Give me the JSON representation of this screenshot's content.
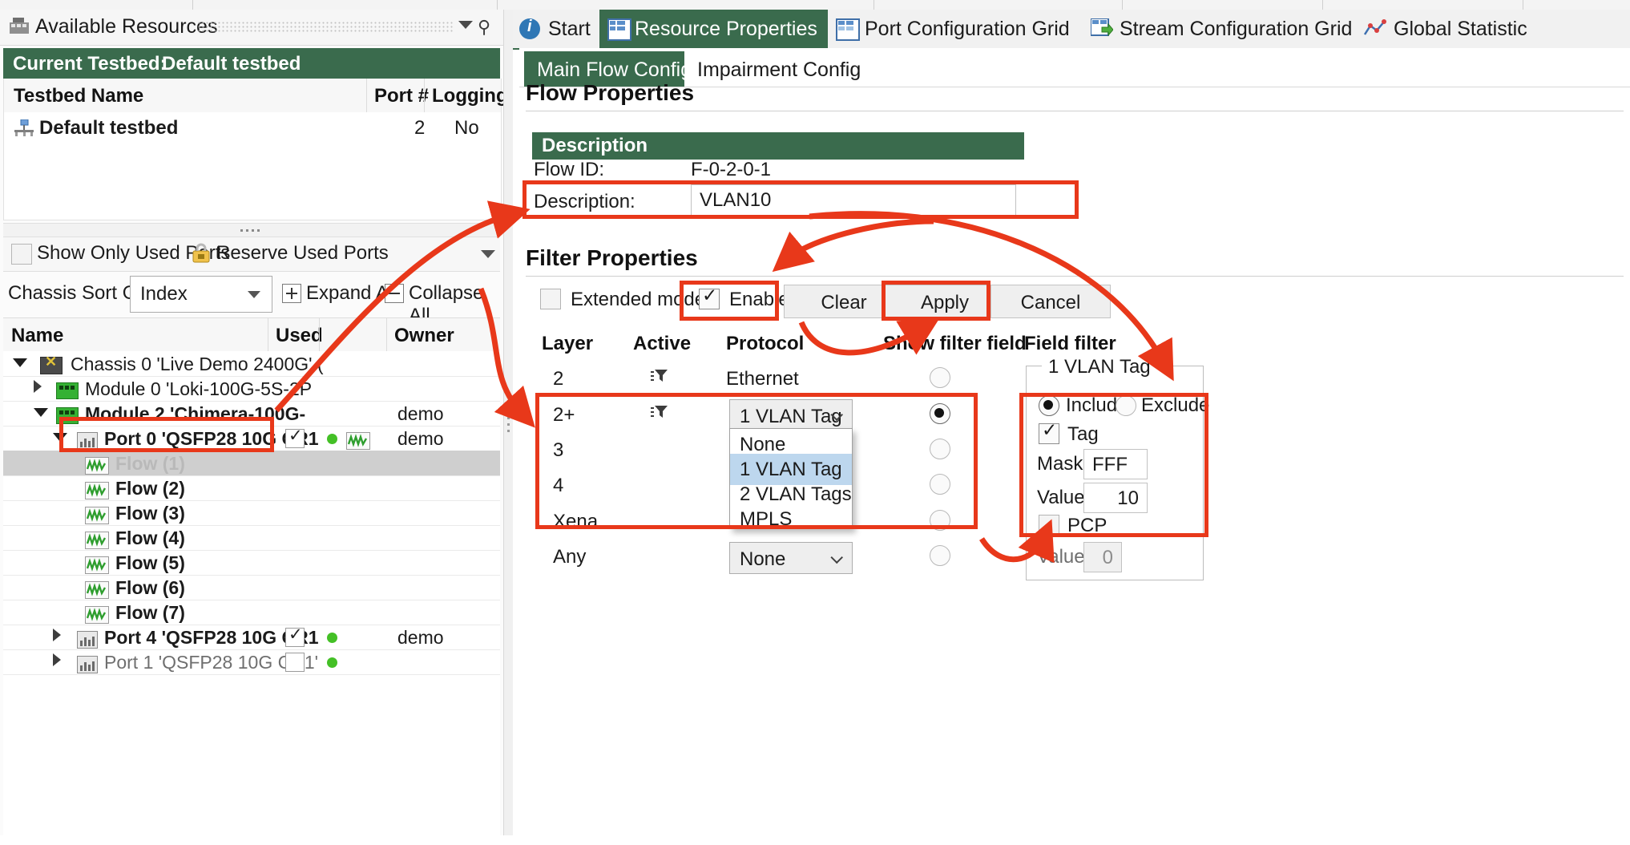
{
  "left_panel": {
    "title": "Available Resources",
    "title_icon": "resources-icon",
    "pin_icon": "pin-icon",
    "collapse_icon": "chevron-down-icon",
    "testbed_header": {
      "prefix": "Current Testbed:",
      "name": "Default testbed"
    },
    "testbed_columns": [
      "Testbed Name",
      "Port #",
      "Logging?"
    ],
    "testbed_rows": [
      {
        "name": "Default testbed",
        "ports": "2",
        "logging": "No",
        "icon": "testbed-icon"
      }
    ],
    "options": {
      "show_only_used_ports": "Show Only Used Ports",
      "show_only_used_ports_checked": false,
      "reserve_used_ports": "Reserve Used Ports",
      "lock_icon": "lock-icon"
    },
    "sort": {
      "label": "Chassis Sort Order:",
      "value": "Index",
      "expand_all": "Expand All",
      "collapse_all": "Collapse All"
    },
    "tree_columns": [
      "Name",
      "Used",
      "",
      "Owner"
    ],
    "tree_rows": [
      {
        "label": "Chassis 0 'Live Demo 2400G' (",
        "indent": 0,
        "icon": "chassis-icon",
        "twisty": "open",
        "bold": false,
        "checkbox": null,
        "dot": false,
        "owner": ""
      },
      {
        "label": "Module 0 'Loki-100G-5S-2P",
        "indent": 1,
        "icon": "module-icon",
        "twisty": "closed",
        "bold": false,
        "checkbox": null,
        "dot": false,
        "owner": ""
      },
      {
        "label": "Module 2 'Chimera-100G-",
        "indent": 1,
        "icon": "module-icon",
        "twisty": "open",
        "bold": true,
        "checkbox": null,
        "dot": false,
        "owner": "demo"
      },
      {
        "label": "Port 0 'QSFP28 10G CR1",
        "indent": 2,
        "icon": "port-icon",
        "twisty": "open",
        "bold": true,
        "checkbox": true,
        "dot": true,
        "flowicon": true,
        "owner": "demo"
      },
      {
        "label": "Flow (1)",
        "indent": 3,
        "icon": "flow-icon",
        "twisty": null,
        "bold": true,
        "selected": true,
        "checkbox": null,
        "dot": false,
        "owner": ""
      },
      {
        "label": "Flow (2)",
        "indent": 3,
        "icon": "flow-icon",
        "twisty": null,
        "bold": true,
        "checkbox": null,
        "dot": false,
        "owner": ""
      },
      {
        "label": "Flow (3)",
        "indent": 3,
        "icon": "flow-icon",
        "twisty": null,
        "bold": true,
        "checkbox": null,
        "dot": false,
        "owner": ""
      },
      {
        "label": "Flow (4)",
        "indent": 3,
        "icon": "flow-icon",
        "twisty": null,
        "bold": true,
        "checkbox": null,
        "dot": false,
        "owner": ""
      },
      {
        "label": "Flow (5)",
        "indent": 3,
        "icon": "flow-icon",
        "twisty": null,
        "bold": true,
        "checkbox": null,
        "dot": false,
        "owner": ""
      },
      {
        "label": "Flow (6)",
        "indent": 3,
        "icon": "flow-icon",
        "twisty": null,
        "bold": true,
        "checkbox": null,
        "dot": false,
        "owner": ""
      },
      {
        "label": "Flow (7)",
        "indent": 3,
        "icon": "flow-icon",
        "twisty": null,
        "bold": true,
        "checkbox": null,
        "dot": false,
        "owner": ""
      },
      {
        "label": "Port 4 'QSFP28 10G CR1",
        "indent": 2,
        "icon": "port-icon",
        "twisty": "closed",
        "bold": true,
        "checkbox": true,
        "dot": true,
        "owner": "demo"
      },
      {
        "label": "Port 1 'QSFP28 10G CR1'",
        "indent": 2,
        "icon": "port-icon",
        "twisty": "closed",
        "bold": false,
        "checkbox": false,
        "dot": true,
        "owner": ""
      }
    ]
  },
  "doc_tabs": [
    {
      "label": "Start",
      "icon": "info-icon",
      "active": false
    },
    {
      "label": "Resource Properties",
      "icon": "grid-icon",
      "active": true
    },
    {
      "label": "Port Configuration Grid",
      "icon": "port-grid-icon",
      "active": false
    },
    {
      "label": "Stream Configuration Grid",
      "icon": "stream-grid-icon",
      "active": false
    },
    {
      "label": "Global Statistic",
      "icon": "statistics-icon",
      "active": false
    }
  ],
  "sub_tabs": [
    {
      "label": "Main Flow Config",
      "active": true
    },
    {
      "label": "Impairment Config",
      "active": false
    }
  ],
  "flow_properties": {
    "heading": "Flow Properties",
    "description_group": "Description",
    "flow_id_label": "Flow ID:",
    "flow_id_value": "F-0-2-0-1",
    "description_label": "Description:",
    "description_value": "VLAN10"
  },
  "filter_properties": {
    "heading": "Filter Properties",
    "extended_mode_label": "Extended mode",
    "extended_mode_checked": false,
    "enable_label": "Enable",
    "enable_checked": true,
    "buttons": [
      "Clear",
      "Apply",
      "Cancel"
    ],
    "columns": [
      "Layer",
      "Active",
      "Protocol",
      "Show filter field",
      "Field filter"
    ],
    "rows": [
      {
        "layer": "2",
        "active_icon": "filter-icon",
        "protocol": "Ethernet",
        "protocol_is_combo": false,
        "show_filter_field": false
      },
      {
        "layer": "2+",
        "active_icon": "filter-icon",
        "protocol": "1 VLAN Tag",
        "protocol_is_combo": true,
        "show_filter_field": true
      },
      {
        "layer": "3",
        "active_icon": null,
        "protocol": "",
        "protocol_is_combo": true,
        "show_filter_field": false
      },
      {
        "layer": "4",
        "active_icon": null,
        "protocol": "",
        "protocol_is_combo": true,
        "show_filter_field": false
      },
      {
        "layer": "Xena",
        "active_icon": null,
        "protocol": "",
        "protocol_is_combo": true,
        "show_filter_field": false
      },
      {
        "layer": "Any",
        "active_icon": null,
        "protocol": "None",
        "protocol_is_combo": true,
        "show_filter_field": false
      }
    ],
    "dropdown": {
      "open": true,
      "options": [
        "None",
        "1 VLAN Tag",
        "2 VLAN Tags",
        "MPLS"
      ],
      "highlighted": "1 VLAN Tag"
    }
  },
  "field_filter": {
    "group_title": "1 VLAN Tag",
    "include_label": "Include",
    "exclude_label": "Exclude",
    "mode": "Include",
    "tag_label": "Tag",
    "tag_checked": true,
    "mask_label": "Mask:",
    "mask_value": "FFF",
    "value_label": "Value:",
    "value_value": "10",
    "pcp_label": "PCP",
    "pcp_checked": false,
    "pcp_value_label": "Value:",
    "pcp_value": "0"
  },
  "colors": {
    "accent_green": "#3a6b4d",
    "annotation_red": "#e8381a",
    "selection_gray": "#cfcfcf",
    "highlight_blue": "#bdd7ee",
    "status_green": "#44c026"
  }
}
